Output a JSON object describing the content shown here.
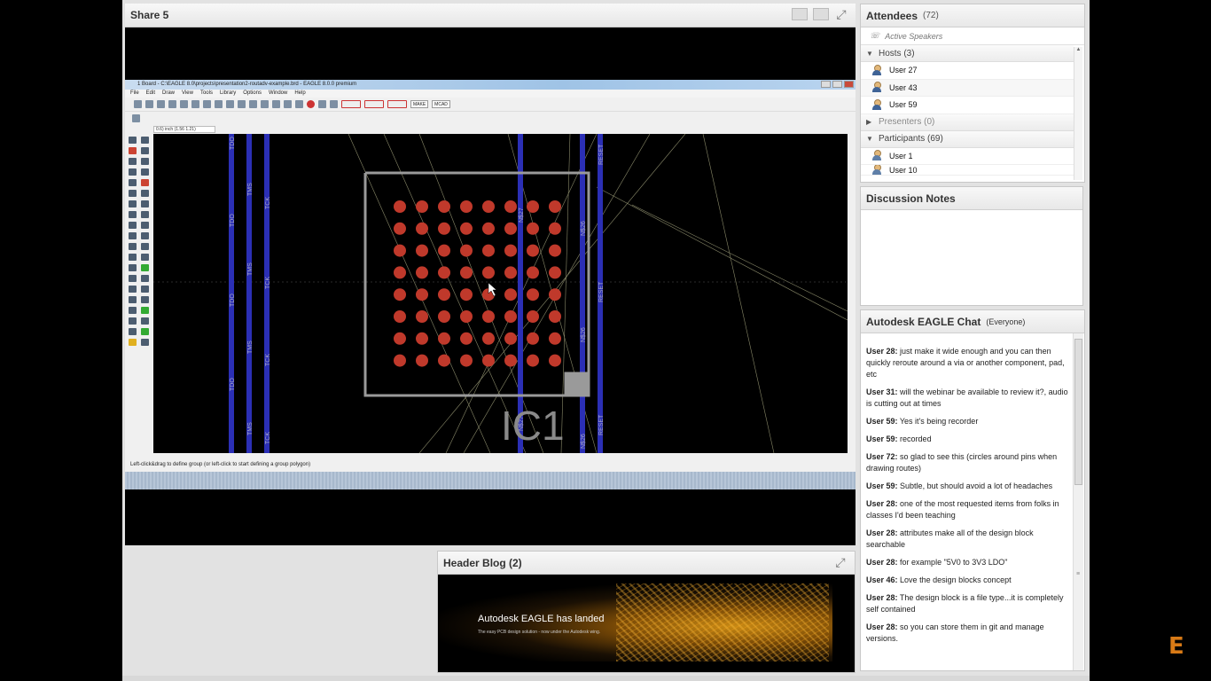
{
  "share": {
    "title": "Share 5"
  },
  "eagle": {
    "window_title": "1 Board - C:\\EAGLE 8.0\\projects\\presentation2-routadv-example.brd - EAGLE 8.0.0 premium",
    "menu": [
      "File",
      "Edit",
      "Draw",
      "View",
      "Tools",
      "Library",
      "Options",
      "Window",
      "Help"
    ],
    "toolbar_make": "MAKE",
    "toolbar_mcad": "MCAD",
    "coord": "0.6) inch (1.56 1.21)",
    "status": "Left-click&drag to define group (or left-click to start defining a group polygon)",
    "trace_labels": [
      "TDO",
      "TMS",
      "TCK",
      "TDO",
      "TMS",
      "TCK",
      "TDO",
      "TMS",
      "TCK"
    ],
    "right_labels": [
      "RESET",
      "RESET",
      "RESET",
      "N$26",
      "N$27",
      "N$26",
      "N$27",
      "N$26"
    ],
    "component": "IC1"
  },
  "attendees": {
    "title": "Attendees",
    "count": "(72)",
    "active_speakers": "Active Speakers",
    "hosts_label": "Hosts (3)",
    "hosts": [
      "User 27",
      "User 43",
      "User 59"
    ],
    "presenters_label": "Presenters (0)",
    "participants_label": "Participants (69)",
    "participants": [
      "User 1",
      "User 10"
    ]
  },
  "notes": {
    "title": "Discussion Notes"
  },
  "chat": {
    "title": "Autodesk EAGLE Chat",
    "audience": "(Everyone)",
    "messages": [
      {
        "who": "User 28:",
        "text": "just make it wide enough and you can then quickly reroute around a via or another component, pad, etc"
      },
      {
        "who": "User 31:",
        "text": "will the webinar be available to review it?, audio is cutting out at times"
      },
      {
        "who": "User 59:",
        "text": "Yes it's being recorder"
      },
      {
        "who": "User 59:",
        "text": "recorded"
      },
      {
        "who": "User 72:",
        "text": "so glad to see this (circles around pins when drawing routes)"
      },
      {
        "who": "User 59:",
        "text": "Subtle, but should avoid a lot of headaches"
      },
      {
        "who": "User 28:",
        "text": "one of the most requested items from folks in classes I'd been teaching"
      },
      {
        "who": "User 28:",
        "text": "attributes make all of the design block searchable"
      },
      {
        "who": "User 28:",
        "text": "for example \"5V0 to 3V3 LDO\""
      },
      {
        "who": "User 46:",
        "text": "Love the design blocks concept"
      },
      {
        "who": "User 28:",
        "text": "The design block is a file type...it is completely self contained"
      },
      {
        "who": "User 28:",
        "text": "so you can store them in git and manage versions."
      }
    ]
  },
  "blog": {
    "title": "Header Blog (2)",
    "headline": "Autodesk EAGLE has landed",
    "subline": "The easy PCB design solution - now under the Autodesk wing."
  },
  "watermark": "E",
  "colors": {
    "accent": "#d87a16",
    "pad": "#c0392b",
    "trace": "#2b2fb5"
  }
}
